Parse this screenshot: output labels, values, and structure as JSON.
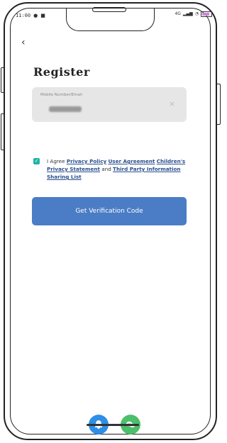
{
  "status_bar": {
    "time": "11:00",
    "left_icons": [
      "app-notification-icon",
      "message-icon"
    ],
    "network": "4G",
    "battery_color": "#c987d8"
  },
  "header": {
    "back_icon": "back-chevron-icon"
  },
  "title": "Register",
  "account_field": {
    "label": "Mobile Number/Email",
    "value": "••••••••",
    "clear_icon": "clear-icon"
  },
  "agreement": {
    "checked": true,
    "prefix": "I Agree ",
    "privacy_policy": "Privacy Policy",
    "user_agreement": "User Agreement",
    "children_privacy": "Children's Privacy Statement",
    "and": " and ",
    "third_party": "Third Party Information Sharing List"
  },
  "cta": {
    "label": "Get Verification Code",
    "color": "#4a7dc5"
  },
  "social_login": [
    {
      "name": "qq-login",
      "icon": "penguin-icon",
      "color": "#2f8fe6"
    },
    {
      "name": "wechat-login",
      "icon": "wechat-icon",
      "color": "#4cbf6a"
    }
  ]
}
